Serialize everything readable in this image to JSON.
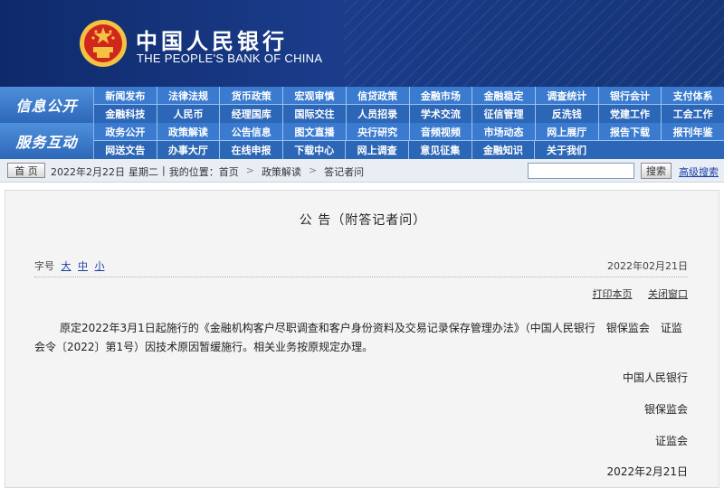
{
  "header": {
    "brand_cn": "中国人民银行",
    "brand_en": "THE PEOPLE'S BANK OF CHINA",
    "colors": {
      "banner": "#143577",
      "nav": "#2f6fc0",
      "emblem_red": "#d0261d",
      "emblem_gold": "#f5c242"
    }
  },
  "nav": {
    "group1_label": "信息公开",
    "group2_label": "服务互动",
    "row1": [
      "新闻发布",
      "法律法规",
      "货币政策",
      "宏观审慎",
      "信贷政策",
      "金融市场",
      "金融稳定",
      "调查统计",
      "银行会计",
      "支付体系"
    ],
    "row2": [
      "金融科技",
      "人民币",
      "经理国库",
      "国际交往",
      "人员招录",
      "学术交流",
      "征信管理",
      "反洗钱",
      "党建工作",
      "工会工作"
    ],
    "row3": [
      "政务公开",
      "政策解读",
      "公告信息",
      "图文直播",
      "央行研究",
      "音频视频",
      "市场动态",
      "网上展厅",
      "报告下载",
      "报刊年鉴"
    ],
    "row4": [
      "网送文告",
      "办事大厅",
      "在线申报",
      "下载中心",
      "网上调查",
      "意见征集",
      "金融知识",
      "关于我们"
    ]
  },
  "crumbs": {
    "home_button": "首 页",
    "date": "2022年2月22日",
    "weekday": "星期二",
    "location_label": "我的位置：首页",
    "sep": ">",
    "item1": "政策解读",
    "item2": "答记者问",
    "search_button": "搜索",
    "adv_search": "高级搜索",
    "search_value": ""
  },
  "article": {
    "title": "公 告（附答记者问）",
    "font_label": "字号",
    "font_large": "大",
    "font_medium": "中",
    "font_small": "小",
    "pub_date": "2022年02月21日",
    "print_link": "打印本页",
    "close_link": "关闭窗口",
    "body": "原定2022年3月1日起施行的《金融机构客户尽职调查和客户身份资料及交易记录保存管理办法》（中国人民银行　银保监会　证监会令〔2022〕第1号）因技术原因暂缓施行。相关业务按原规定办理。",
    "sign1": "中国人民银行",
    "sign2": "银保监会",
    "sign3": "证监会",
    "sign_date": "2022年2月21日"
  }
}
